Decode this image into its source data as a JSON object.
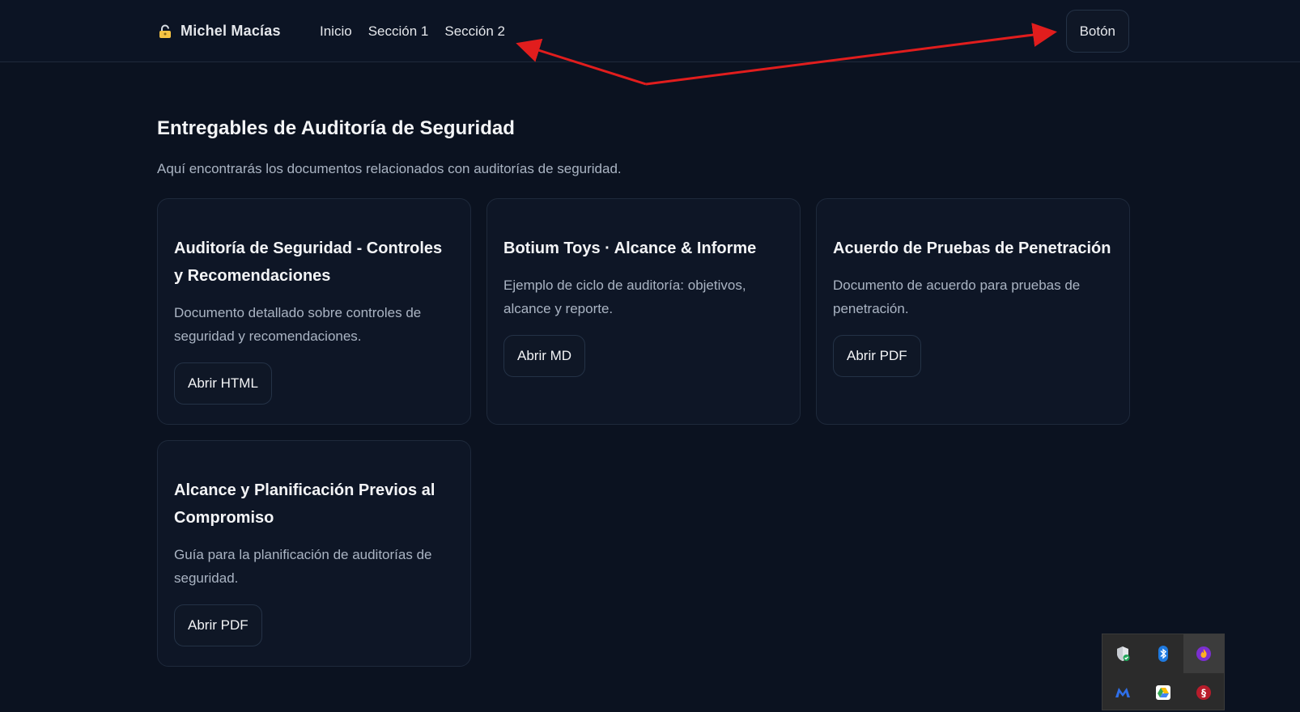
{
  "header": {
    "brand": "Michel Macías",
    "nav": [
      "Inicio",
      "Sección 1",
      "Sección 2"
    ],
    "button": "Botón"
  },
  "page": {
    "title": "Entregables de Auditoría de Seguridad",
    "subtitle": "Aquí encontrarás los documentos relacionados con auditorías de seguridad."
  },
  "cards": [
    {
      "title": "Auditoría de Seguridad - Controles y Recomendaciones",
      "desc": "Documento detallado sobre controles de seguridad y recomendaciones.",
      "button": "Abrir HTML"
    },
    {
      "title": "Botium Toys · Alcance & Informe",
      "desc": "Ejemplo de ciclo de auditoría: objetivos, alcance y reporte.",
      "button": "Abrir MD"
    },
    {
      "title": "Acuerdo de Pruebas de Penetración",
      "desc": "Documento de acuerdo para pruebas de penetración.",
      "button": "Abrir PDF"
    },
    {
      "title": "Alcance y Planificación Previos al Compromiso",
      "desc": "Guía para la planificación de auditorías de seguridad.",
      "button": "Abrir PDF"
    }
  ],
  "tray": {
    "icons": [
      "shield-check-icon",
      "bluetooth-icon",
      "fire-icon",
      "malwarebytes-icon",
      "google-drive-icon",
      "red-s-icon"
    ]
  },
  "colors": {
    "background": "#0b1220",
    "card": "#0e1626",
    "border": "#1e293b",
    "annotation_arrow": "#e11d1d"
  }
}
